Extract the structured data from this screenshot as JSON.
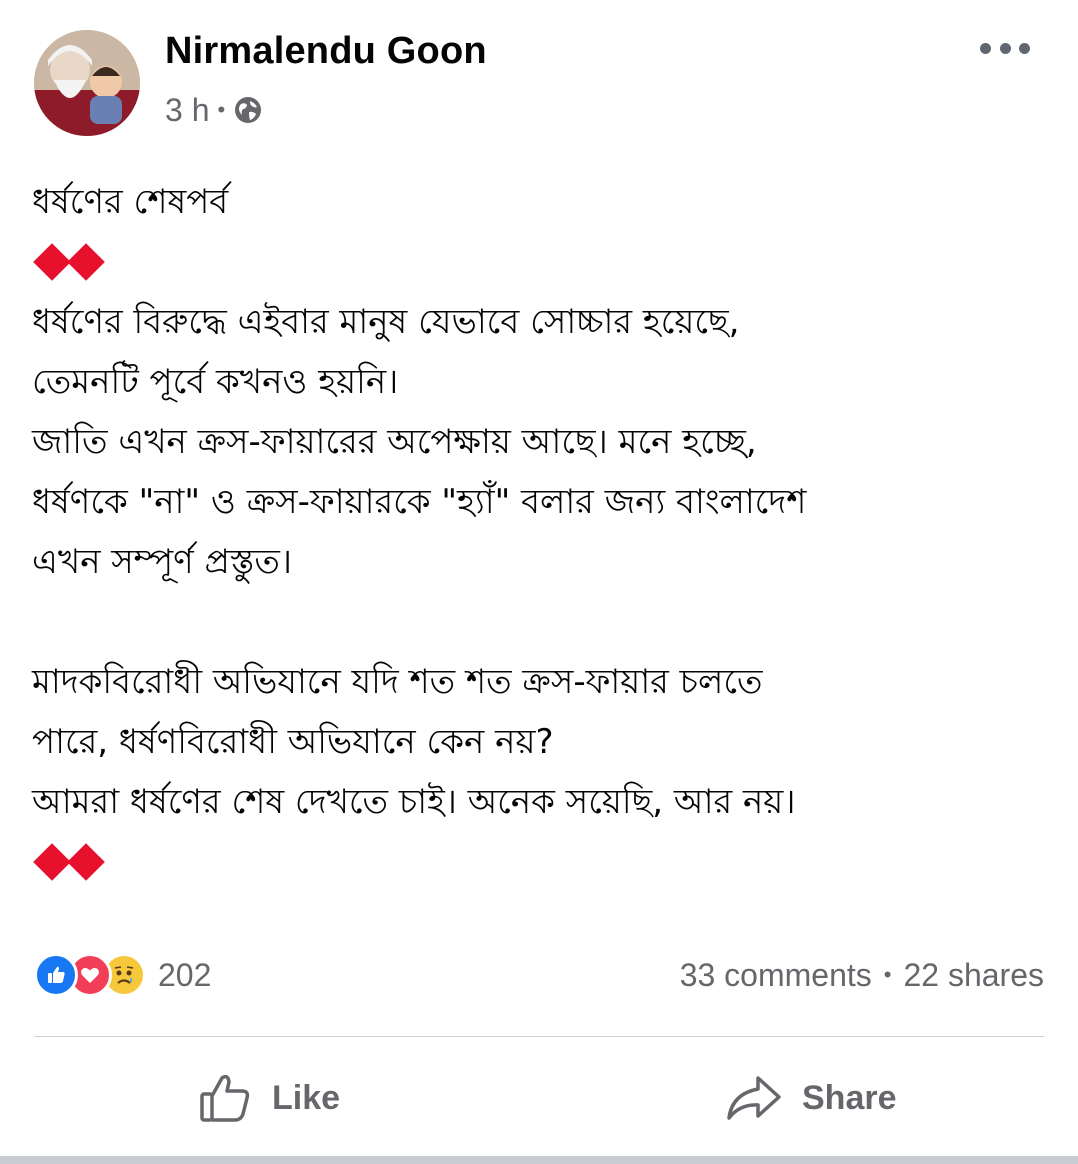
{
  "post": {
    "author": "Nirmalendu Goon",
    "time": "3 h",
    "separator": "•",
    "privacy_icon": "globe-icon",
    "more_icon": "more-options-icon",
    "body": {
      "title": "ধর্ষণের শেষপর্ব",
      "para1_line1": "ধর্ষণের বিরুদ্ধে এইবার মানুষ যেভাবে সোচ্চার হয়েছে,",
      "para1_line2": "তেমনটি পূর্বে কখনও হয়নি।",
      "para1_line3": "জাতি এখন ক্রস-ফায়ারের অপেক্ষায় আছে। মনে হচ্ছে,",
      "para1_line4": "ধর্ষণকে \"না\" ও ক্রস-ফায়ারকে \"হ্যাঁ\" বলার জন্য বাংলাদেশ",
      "para1_line5": "এখন সম্পূর্ণ প্রস্তুত।",
      "para2_line1": "মাদকবিরোধী অভিযানে যদি শত শত ক্রস-ফায়ার চলতে",
      "para2_line2": "পারে, ধর্ষণবিরোধী অভিযানে কেন নয়?",
      "para2_line3": "আমরা ধর্ষণের শেষ দেখতে চাই। অনেক সয়েছি, আর নয়।"
    },
    "diamond_color": "#e8112d"
  },
  "engagement": {
    "reaction_icons": [
      "like-icon",
      "love-icon",
      "sad-icon"
    ],
    "reaction_count": "202",
    "comments": "33 comments",
    "shares": "22 shares",
    "separator": "•"
  },
  "actions": {
    "like_label": "Like",
    "share_label": "Share"
  },
  "colors": {
    "like_blue": "#1877f2",
    "love_red": "#f33e58",
    "sad_yellow": "#f7c83b",
    "secondary_text": "#65676b"
  }
}
